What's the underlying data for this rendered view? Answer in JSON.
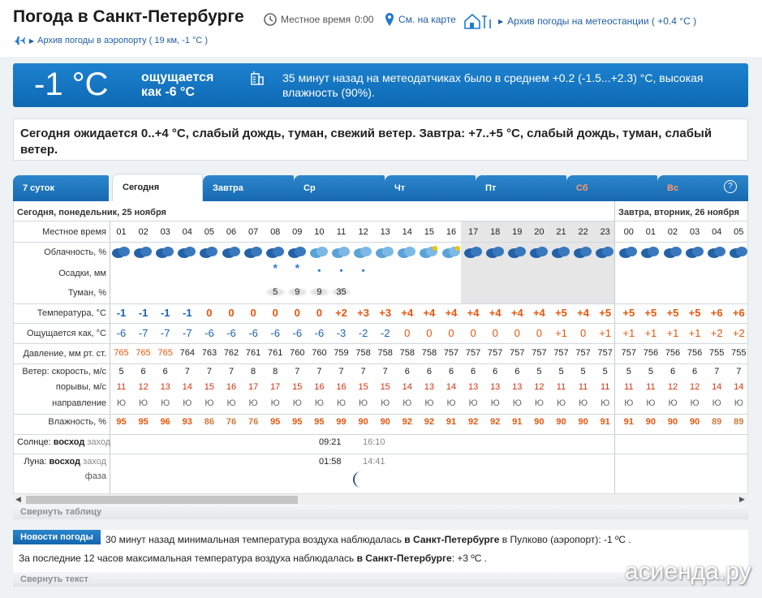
{
  "header": {
    "title": "Погода в Санкт-Петербурге",
    "local_time_label": "Местное время",
    "local_time": "0:00",
    "map_link": "См. на карте",
    "station_archive": "Архив погоды на метеостанции ( +0.4 °C )",
    "airport_archive": "Архив погоды в аэропорту ( 19 км, -1 °C )"
  },
  "banner": {
    "temp": "-1 °C",
    "feels_line1": "ощущается",
    "feels_line2": "как -6 °C",
    "message": "35 минут назад на метеодатчиках было в среднем +0.2 (-1.5...+2.3) °C, высокая влажность (90%)."
  },
  "forecast": "Сегодня ожидается 0..+4 °C, слабый дождь, туман, свежий ветер. Завтра: +7..+5 °C, слабый дождь, туман, слабый ветер.",
  "tabs": [
    {
      "label": "7 суток"
    },
    {
      "label": "Сегодня"
    },
    {
      "label": "Завтра"
    },
    {
      "label": "Ср"
    },
    {
      "label": "Чт"
    },
    {
      "label": "Пт"
    },
    {
      "label": "Сб"
    },
    {
      "label": "Вс"
    }
  ],
  "help": "?",
  "day_headers": {
    "today": "Сегодня, понедельник, 25 ноября",
    "tomorrow": "Завтра, вторник, 26 ноября"
  },
  "row_labels": {
    "time": "Местное время",
    "clouds": "Облачность, %",
    "precip": "Осадки, мм",
    "fog": "Туман, %",
    "temp": "Температура, °C",
    "feels": "Ощущается как, °C",
    "pressure": "Давление, мм рт. ст.",
    "wind": "Ветер: скорость, м/с",
    "gusts": "порывы, м/с",
    "direction": "направление",
    "humidity": "Влажность, %"
  },
  "hours": [
    "01",
    "02",
    "03",
    "04",
    "05",
    "06",
    "07",
    "08",
    "09",
    "10",
    "11",
    "12",
    "13",
    "14",
    "15",
    "16",
    "17",
    "18",
    "19",
    "20",
    "21",
    "22",
    "23",
    "00",
    "01",
    "02",
    "03",
    "04",
    "05"
  ],
  "fog": [
    "",
    "",
    "",
    "",
    "",
    "",
    "",
    "5",
    "9",
    "9",
    "35",
    "",
    "",
    "",
    "",
    "",
    "",
    "",
    "",
    "",
    "",
    "",
    "",
    "",
    "",
    "",
    "",
    "",
    ""
  ],
  "temps": [
    "-1",
    "-1",
    "-1",
    "-1",
    "0",
    "0",
    "0",
    "0",
    "0",
    "0",
    "+2",
    "+3",
    "+3",
    "+4",
    "+4",
    "+4",
    "+4",
    "+4",
    "+4",
    "+4",
    "+5",
    "+4",
    "+5",
    "+5",
    "+5",
    "+5",
    "+5",
    "+6",
    "+6"
  ],
  "feels": [
    "-6",
    "-7",
    "-7",
    "-7",
    "-6",
    "-6",
    "-6",
    "-6",
    "-6",
    "-6",
    "-3",
    "-2",
    "-2",
    "0",
    "0",
    "0",
    "0",
    "0",
    "0",
    "0",
    "+1",
    "0",
    "+1",
    "+1",
    "+1",
    "+1",
    "+1",
    "+2",
    "+2"
  ],
  "pressure": [
    "765",
    "765",
    "765",
    "764",
    "763",
    "762",
    "761",
    "761",
    "760",
    "760",
    "759",
    "758",
    "758",
    "758",
    "758",
    "757",
    "757",
    "757",
    "757",
    "757",
    "757",
    "757",
    "757",
    "757",
    "756",
    "756",
    "756",
    "755",
    "755"
  ],
  "wind": [
    "5",
    "6",
    "6",
    "7",
    "7",
    "7",
    "8",
    "8",
    "7",
    "7",
    "7",
    "7",
    "7",
    "6",
    "6",
    "6",
    "6",
    "6",
    "6",
    "5",
    "5",
    "5",
    "5",
    "5",
    "5",
    "6",
    "6",
    "7",
    "7"
  ],
  "gusts": [
    "11",
    "12",
    "13",
    "14",
    "15",
    "16",
    "17",
    "17",
    "15",
    "16",
    "16",
    "15",
    "15",
    "14",
    "13",
    "14",
    "13",
    "13",
    "13",
    "12",
    "11",
    "11",
    "11",
    "11",
    "11",
    "12",
    "12",
    "14",
    "14"
  ],
  "direction": "Ю",
  "humidity": [
    "95",
    "95",
    "96",
    "93",
    "86",
    "76",
    "76",
    "95",
    "95",
    "95",
    "99",
    "90",
    "90",
    "92",
    "92",
    "91",
    "92",
    "92",
    "91",
    "90",
    "90",
    "90",
    "91",
    "91",
    "90",
    "90",
    "90",
    "89",
    "89"
  ],
  "sun": {
    "label_prefix": "Солнце:",
    "rise_label": "восход",
    "set_label": "заход",
    "rise": "09:21",
    "set": "16:10"
  },
  "moon": {
    "label_prefix": "Луна:",
    "rise_label": "восход",
    "set_label": "заход",
    "phase_label": "фаза",
    "rise": "01:58",
    "set": "14:41"
  },
  "collapse_table": "Свернуть таблицу",
  "news": {
    "badge": "Новости погоды",
    "line1_a": "30 минут назад минимальная температура воздуха наблюдалась ",
    "line1_b": "в Санкт-Петербурге",
    "line1_c": " в Пулково (аэропорт): -1 ºC .",
    "line2_a": "За последние 12 часов максимальная температура воздуха наблюдалась ",
    "line2_b": "в Санкт-Петербурге",
    "line2_c": ": +3 ºC ."
  },
  "collapse_text": "Свернуть текст",
  "watermark": "асиенда.ру",
  "colors": {
    "blue": "#1c63b7",
    "orange": "#e8560c",
    "neutral": "#222"
  }
}
